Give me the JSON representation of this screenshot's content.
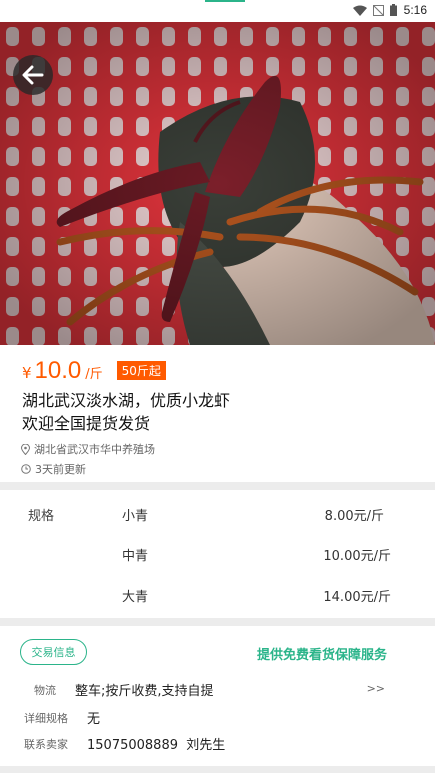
{
  "status_bar": {
    "time": "5:16"
  },
  "product": {
    "price_symbol": "¥",
    "price": "10.0",
    "unit": "/斤",
    "min_order": "50斤起",
    "title_line1": "湖北武汉淡水湖，优质小龙虾",
    "title_line2": "欢迎全国提货发货",
    "location": "湖北省武汉市华中养殖场",
    "updated": "3天前更新"
  },
  "spec": {
    "label": "规格",
    "rows": [
      {
        "name": "小青",
        "price": "8.00元/斤"
      },
      {
        "name": "中青",
        "price": "10.00元/斤"
      },
      {
        "name": "大青",
        "price": "14.00元/斤"
      }
    ]
  },
  "trade": {
    "tag": "交易信息",
    "promo": "提供免费看货保障服务",
    "logistics_label": "物流",
    "logistics_value": "整车;按斤收费,支持自提",
    "more": ">>",
    "detail_label": "详细规格",
    "detail_value": "无",
    "contact_label": "联系卖家",
    "contact_value": "15075008889  刘先生"
  },
  "colors": {
    "accent": "#2bb48a",
    "price": "#ff5a00"
  }
}
